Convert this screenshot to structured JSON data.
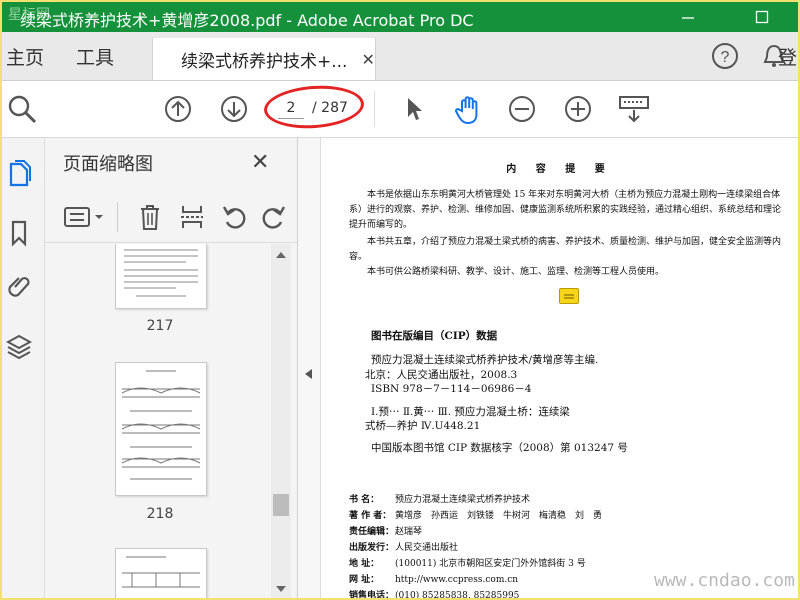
{
  "window": {
    "title": "续梁式桥养护技术+黄增彦2008.pdf - Adobe Acrobat Pro DC",
    "title_watermark": "星标网",
    "colors": {
      "titlebar": "#16913b",
      "annotation": "#e42424"
    }
  },
  "tabs": {
    "home": "主页",
    "tools": "工具",
    "document": "续梁式桥养护技术+...",
    "close": "✕",
    "sign_in": "登"
  },
  "toolbar": {
    "page_current": "2",
    "page_total": "/ 287"
  },
  "panel": {
    "title": "页面缩略图",
    "close": "✕",
    "thumbnails": [
      {
        "page": "217"
      },
      {
        "page": "218"
      }
    ]
  },
  "document": {
    "heading": "内 容 提 要",
    "summary": [
      "本书是依据山东东明黄河大桥管理处 15 年来对东明黄河大桥（主桥为预应力混凝土刚构一连续梁组合体系）进行的观察、养护、检测、维修加固、健康监测系统所积累的实践经验，通过精心组织、系统总结和理论提升而编写的。",
      "本书共五章，介绍了预应力混凝土梁式桥的病害、养护技术、质量检测、维护与加固，健全安全监测等内容。",
      "本书可供公路桥梁科研、教学、设计、施工、监理、检测等工程人员使用。"
    ],
    "cip": {
      "title": "图书在版编目（CIP）数据",
      "lines": [
        "预应力混凝土连续梁式桥养护技术/黄增彦等主编.",
        "北京：人民交通出版社，2008.3",
        "ISBN 978－7－114－06986－4",
        "Ⅰ.预⋯ Ⅱ.黄⋯ Ⅲ. 预应力混凝土桥：连续梁",
        "式桥—养护 Ⅳ.U448.21",
        "中国版本图书馆 CIP 数据核字（2008）第 013247 号"
      ]
    },
    "biblio": [
      {
        "label": "书 名：",
        "value": "预应力混凝土连续梁式桥养护技术"
      },
      {
        "label": "著 作 者：",
        "value": "黄增彦　孙西运　刘铁镂　牛树河　梅清稳　刘　勇"
      },
      {
        "label": "责任编辑：",
        "value": "赵瑞琴"
      },
      {
        "label": "出版发行：",
        "value": "人民交通出版社"
      },
      {
        "label": "地 址：",
        "value": "(100011) 北京市朝阳区安定门外外馆斜街 3 号"
      },
      {
        "label": "网 址：",
        "value": "http://www.ccpress.com.cn"
      },
      {
        "label": "销售电话：",
        "value": "(010) 85285838, 85285995"
      }
    ]
  },
  "watermark": "www.cndao.com"
}
